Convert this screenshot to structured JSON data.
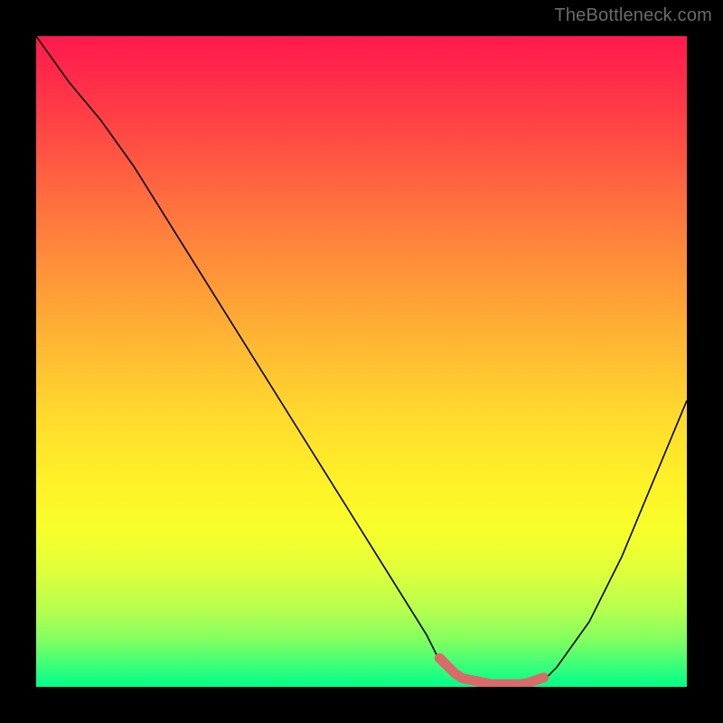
{
  "watermark": "TheBottleneck.com",
  "chart_data": {
    "type": "line",
    "title": "",
    "xlabel": "",
    "ylabel": "",
    "xlim": [
      0,
      100
    ],
    "ylim": [
      0,
      100
    ],
    "grid": false,
    "legend": false,
    "series": [
      {
        "name": "bottleneck-curve",
        "x": [
          0,
          5,
          10,
          15,
          20,
          25,
          30,
          35,
          40,
          45,
          50,
          55,
          60,
          62,
          65,
          70,
          75,
          78,
          80,
          85,
          90,
          95,
          100
        ],
        "y": [
          100,
          93,
          87,
          80,
          72,
          64,
          56,
          48,
          40,
          32,
          24,
          16,
          8,
          4,
          1,
          0,
          0,
          1,
          3,
          10,
          20,
          32,
          44
        ]
      }
    ],
    "highlight_zone": {
      "name": "optimal-range",
      "x_start": 62,
      "x_end": 78,
      "color": "#d96a6a"
    },
    "background_gradient": {
      "top": "#ff1a4d",
      "mid": "#ffd92e",
      "bottom": "#00ff88"
    }
  }
}
